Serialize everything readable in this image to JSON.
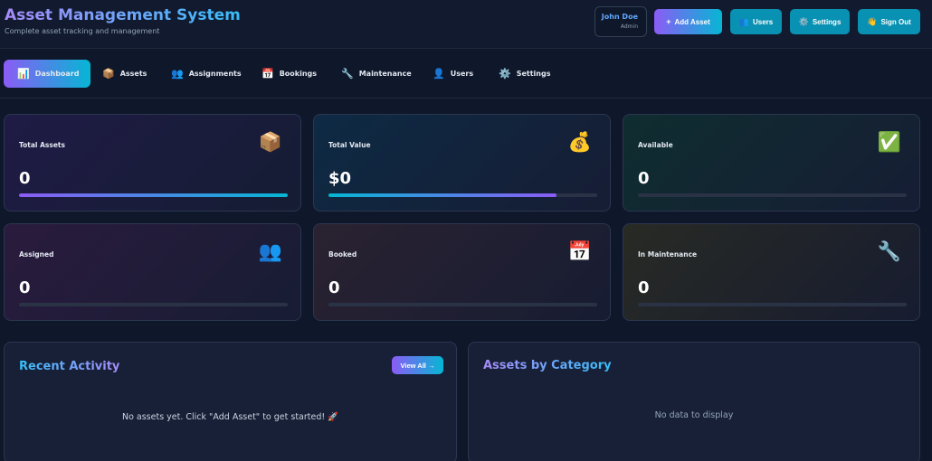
{
  "header": {
    "title": "Asset Management System",
    "subtitle": "Complete asset tracking and management",
    "user": {
      "name": "John Doe",
      "role": "Admin"
    },
    "buttons": {
      "add_asset": {
        "icon": "+",
        "label": "Add Asset"
      },
      "users": {
        "icon": "👥",
        "label": "Users"
      },
      "settings": {
        "icon": "⚙️",
        "label": "Settings"
      },
      "sign_out": {
        "icon": "👋",
        "label": "Sign Out"
      }
    }
  },
  "nav": {
    "tabs": [
      {
        "icon": "📊",
        "label": "Dashboard",
        "active": true
      },
      {
        "icon": "📦",
        "label": "Assets"
      },
      {
        "icon": "👥",
        "label": "Assignments"
      },
      {
        "icon": "📅",
        "label": "Bookings"
      },
      {
        "icon": "🔧",
        "label": "Maintenance"
      },
      {
        "icon": "👤",
        "label": "Users"
      },
      {
        "icon": "⚙️",
        "label": "Settings"
      }
    ]
  },
  "stats": [
    {
      "label": "Total Assets",
      "value": "0",
      "icon": "📦",
      "progress": 100
    },
    {
      "label": "Total Value",
      "value": "$0",
      "icon": "💰",
      "progress": 85
    },
    {
      "label": "Available",
      "value": "0",
      "icon": "✅",
      "progress": 0
    },
    {
      "label": "Assigned",
      "value": "0",
      "icon": "👥",
      "progress": 0
    },
    {
      "label": "Booked",
      "value": "0",
      "icon": "📅",
      "progress": 0
    },
    {
      "label": "In Maintenance",
      "value": "0",
      "icon": "🔧",
      "progress": 0
    }
  ],
  "recent_activity": {
    "title": "Recent Activity",
    "view_all_label": "View All →",
    "empty_message": "No assets yet. Click \"Add Asset\" to get started! 🚀"
  },
  "assets_by_category": {
    "title": "Assets by Category",
    "empty_message": "No data to display"
  },
  "colors": {
    "accent_start": "#8b5cf6",
    "accent_end": "#06b6d4",
    "background": "#0f172a"
  }
}
